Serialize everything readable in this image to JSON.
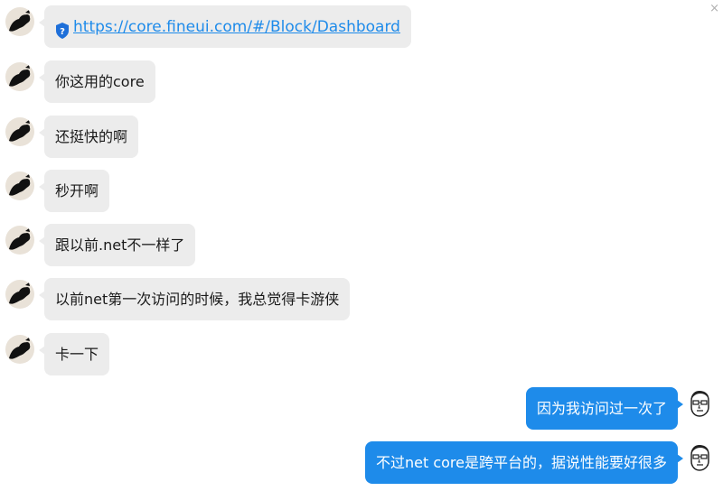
{
  "window": {
    "close_glyph": "×"
  },
  "messages": [
    {
      "side": "incoming",
      "type": "link",
      "text": "https://core.fineui.com/#/Block/Dashboard",
      "icon": "shield-question-icon"
    },
    {
      "side": "incoming",
      "type": "text",
      "text": "你这用的core"
    },
    {
      "side": "incoming",
      "type": "text",
      "text": "还挺快的啊"
    },
    {
      "side": "incoming",
      "type": "text",
      "text": "秒开啊"
    },
    {
      "side": "incoming",
      "type": "text",
      "text": "跟以前.net不一样了"
    },
    {
      "side": "incoming",
      "type": "text",
      "text": "以前net第一次访问的时候，我总觉得卡游侠"
    },
    {
      "side": "incoming",
      "type": "text",
      "text": "卡一下"
    },
    {
      "side": "outgoing",
      "type": "text",
      "text": "因为我访问过一次了"
    },
    {
      "side": "outgoing",
      "type": "text",
      "text": "不过net core是跨平台的，据说性能要好很多"
    }
  ],
  "colors": {
    "incoming_bubble": "#ececec",
    "outgoing_bubble": "#1e8bea",
    "link": "#1e8bea"
  }
}
